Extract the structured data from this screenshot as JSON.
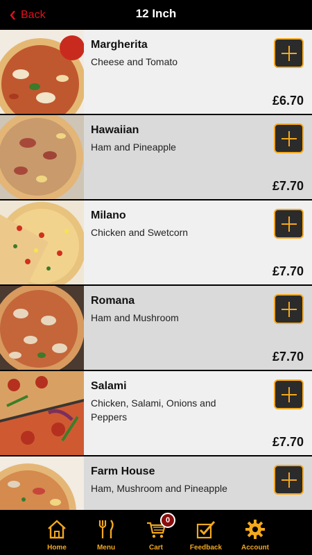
{
  "header": {
    "back_label": "Back",
    "title": "12 Inch"
  },
  "colors": {
    "accent": "#f4a81e",
    "back": "#e3111b",
    "badge": "#8a0d0d"
  },
  "items": [
    {
      "name": "Margherita",
      "description": "Cheese and Tomato",
      "price": "£6.70"
    },
    {
      "name": "Hawaiian",
      "description": "Ham and Pineapple",
      "price": "£7.70"
    },
    {
      "name": "Milano",
      "description": "Chicken and Swetcorn",
      "price": "£7.70"
    },
    {
      "name": "Romana",
      "description": "Ham and Mushroom",
      "price": "£7.70"
    },
    {
      "name": "Salami",
      "description": "Chicken, Salami, Onions and Peppers",
      "price": "£7.70"
    },
    {
      "name": "Farm House",
      "description": "Ham, Mushroom and Pineapple",
      "price": ""
    }
  ],
  "tabbar": {
    "home": "Home",
    "menu": "Menu",
    "cart": "Cart",
    "cart_count": "0",
    "feedback": "Feedback",
    "account": "Account"
  }
}
